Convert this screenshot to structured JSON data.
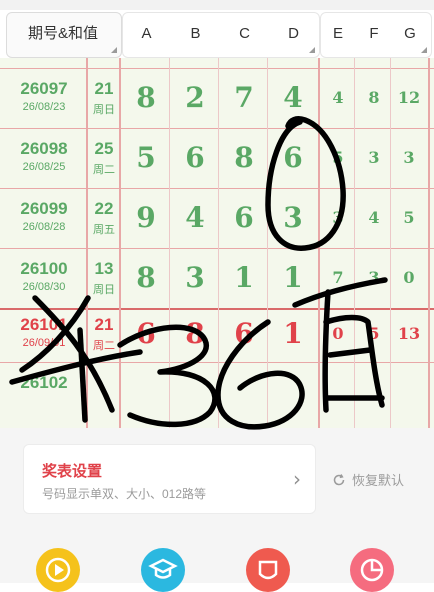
{
  "header": {
    "issue_col": "期号&和值",
    "columns": [
      "A",
      "B",
      "C",
      "D",
      "E",
      "F",
      "G"
    ]
  },
  "rows": [
    {
      "issue": "26097",
      "date": "26/08/23",
      "sum": "21",
      "weekday": "周日",
      "digits": [
        "8",
        "2",
        "7",
        "4"
      ],
      "extra": [
        "4",
        "8",
        "12"
      ],
      "color": "green"
    },
    {
      "issue": "26098",
      "date": "26/08/25",
      "sum": "25",
      "weekday": "周二",
      "digits": [
        "5",
        "6",
        "8",
        "6"
      ],
      "extra": [
        "5",
        "3",
        "3"
      ],
      "color": "green"
    },
    {
      "issue": "26099",
      "date": "26/08/28",
      "sum": "22",
      "weekday": "周五",
      "digits": [
        "9",
        "4",
        "6",
        "3"
      ],
      "extra": [
        "3",
        "4",
        "5"
      ],
      "color": "green"
    },
    {
      "issue": "26100",
      "date": "26/08/30",
      "sum": "13",
      "weekday": "周日",
      "digits": [
        "8",
        "3",
        "1",
        "1"
      ],
      "extra": [
        "7",
        "3",
        "0"
      ],
      "color": "green"
    },
    {
      "issue": "26101",
      "date": "26/09/01",
      "sum": "21",
      "weekday": "周二",
      "digits": [
        "6",
        "8",
        "6",
        "1"
      ],
      "extra": [
        "0",
        "5",
        "13"
      ],
      "color": "red"
    },
    {
      "issue": "26102",
      "date": "",
      "sum": "",
      "weekday": "",
      "digits": [
        "",
        "",
        "",
        ""
      ],
      "extra": [
        "",
        "",
        ""
      ],
      "color": "green"
    }
  ],
  "settings": {
    "title": "奖表设置",
    "subtitle": "号码显示单双、大小、012路等",
    "reset_label": "恢复默认"
  },
  "handwriting": {
    "text": "杀36百",
    "digit_above": "0"
  },
  "bottom_icons": [
    {
      "name": "play-icon",
      "color": "#f5c21b"
    },
    {
      "name": "graduate-icon",
      "color": "#2bb8e0"
    },
    {
      "name": "shield-icon",
      "color": "#ef5a4f"
    },
    {
      "name": "pie-icon",
      "color": "#f56c7f"
    }
  ],
  "colors": {
    "green": "#5aa865",
    "red": "#e0424a",
    "grid_line": "#e8a7a7",
    "grid_bg": "#f4f8ec"
  }
}
